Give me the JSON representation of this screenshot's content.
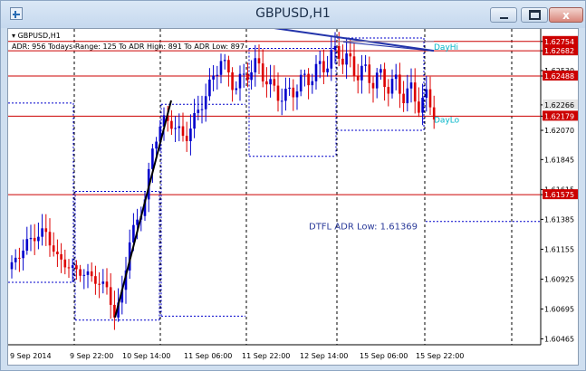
{
  "window": {
    "title": "GBPUSD,H1",
    "buttons": {
      "minimize": "minimize-icon",
      "maximize": "maximize-icon",
      "close_label": "x"
    }
  },
  "chart_header": {
    "symbol_line": "GBPUSD,H1",
    "adr_line": "ADR: 956  Todays Range: 125  To ADR High: 891  To ADR Low: 897"
  },
  "colors": {
    "bull": "#0000cc",
    "bear": "#dd0000",
    "level_line": "#cc0000",
    "dotted": "#0000cc",
    "label_cyan": "#00b5c8"
  },
  "annotations": {
    "day_hi": "DayHi",
    "day_lo": "DayLo",
    "dtfl": "DTFL ADR Low: 1.61369"
  },
  "chart_data": {
    "type": "candlestick",
    "symbol": "GBPUSD",
    "timeframe": "H1",
    "y_ticks": [
      "1.62754",
      "1.62682",
      "1.62530",
      "1.62488",
      "1.62266",
      "1.62179",
      "1.62070",
      "1.61845",
      "1.61615",
      "1.61575",
      "1.61385",
      "1.61155",
      "1.60925",
      "1.60695",
      "1.60465"
    ],
    "highlighted_levels": [
      "1.62754",
      "1.62682",
      "1.62488",
      "1.62179",
      "1.61575"
    ],
    "current_price": "1.62266",
    "x_ticks": [
      "9 Sep 2014",
      "9 Sep 22:00",
      "10 Sep 14:00",
      "11 Sep 06:00",
      "11 Sep 22:00",
      "12 Sep 14:00",
      "15 Sep 06:00",
      "15 Sep 22:00"
    ],
    "ylim": [
      1.6042,
      1.6285
    ],
    "levels": [
      1.62754,
      1.62682,
      1.62488,
      1.62179,
      1.61575
    ]
  }
}
